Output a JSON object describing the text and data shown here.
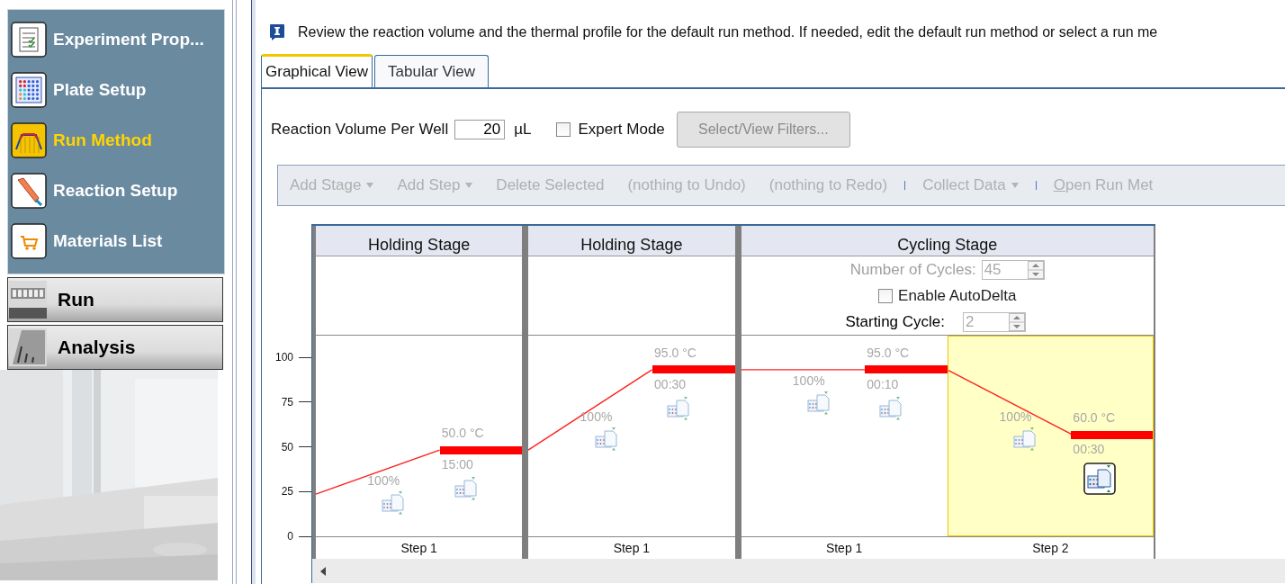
{
  "sidebar": {
    "items": [
      {
        "label": "Experiment Prop...",
        "kind": "notes",
        "selected": false
      },
      {
        "label": "Plate Setup",
        "kind": "plate",
        "selected": false
      },
      {
        "label": "Run Method",
        "kind": "method",
        "selected": true
      },
      {
        "label": "Reaction Setup",
        "kind": "pipette",
        "selected": false
      },
      {
        "label": "Materials List",
        "kind": "cart",
        "selected": false
      }
    ],
    "sections": [
      {
        "label": "Run",
        "kind": "run"
      },
      {
        "label": "Analysis",
        "kind": "analysis"
      }
    ]
  },
  "message": "Review the reaction volume and the thermal profile for the default run method. If needed, edit the default run method or select a run me",
  "tabs": [
    {
      "label": "Graphical View",
      "selected": true
    },
    {
      "label": "Tabular View",
      "selected": false
    }
  ],
  "form": {
    "volume_label": "Reaction Volume Per Well",
    "volume": "20",
    "unit": "µL",
    "expert_mode": {
      "label": "Expert Mode",
      "checked": false
    },
    "filters_button": {
      "label": "Select/View Filters...",
      "disabled": true
    }
  },
  "toolbar": [
    {
      "kind": "menu",
      "label": "Add Stage",
      "disabled": true
    },
    {
      "kind": "menu",
      "label": "Add Step",
      "disabled": true
    },
    {
      "kind": "action",
      "label": "Delete Selected",
      "disabled": true
    },
    {
      "kind": "action",
      "label": "(nothing to Undo)",
      "disabled": true
    },
    {
      "kind": "action",
      "label": "(nothing to Redo)",
      "disabled": true
    },
    {
      "kind": "separator"
    },
    {
      "kind": "menu",
      "label": "Collect Data",
      "disabled": true
    },
    {
      "kind": "separator"
    },
    {
      "kind": "action",
      "label": "Open Run Met",
      "disabled": true,
      "mnemonic": true
    }
  ],
  "chart": {
    "y_ticks": [
      "100",
      "75",
      "50",
      "25",
      "0"
    ],
    "stages": [
      {
        "title": "Holding Stage",
        "steps": [
          {
            "label": "Step 1",
            "temperature": "50.0 °C",
            "time": "15:00",
            "ramp": "100%",
            "selected": false,
            "collect_data": false
          }
        ]
      },
      {
        "title": "Holding Stage",
        "steps": [
          {
            "label": "Step 1",
            "temperature": "95.0 °C",
            "time": "00:30",
            "ramp": "100%",
            "selected": false,
            "collect_data": false
          }
        ]
      },
      {
        "title": "Cycling Stage",
        "settings": {
          "cycles_label": "Number of Cycles:",
          "cycles": "45",
          "autodelta": {
            "label": "Enable AutoDelta",
            "checked": false
          },
          "start_label": "Starting Cycle:",
          "start_cycle": "2"
        },
        "steps": [
          {
            "label": "Step 1",
            "temperature": "95.0 °C",
            "time": "00:10",
            "ramp": "100%",
            "selected": false,
            "collect_data": false
          },
          {
            "label": "Step 2",
            "temperature": "60.0 °C",
            "time": "00:30",
            "ramp": "100%",
            "selected": true,
            "collect_data": true
          }
        ]
      }
    ]
  }
}
